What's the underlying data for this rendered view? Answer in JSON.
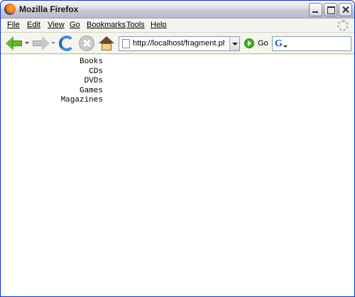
{
  "window": {
    "title": "Mozilla Firefox"
  },
  "menubar": {
    "items": [
      {
        "label": "File"
      },
      {
        "label": "Edit"
      },
      {
        "label": "View"
      },
      {
        "label": "Go"
      },
      {
        "label": "Bookmarks"
      },
      {
        "label": "Tools"
      },
      {
        "label": "Help"
      }
    ]
  },
  "toolbar": {
    "url": "http://localhost/fragment.php",
    "go_label": "Go",
    "search_engine_glyph": "G",
    "search_value": ""
  },
  "content": {
    "items": [
      "Books",
      "CDs",
      "DVDs",
      "Games",
      "Magazines"
    ]
  },
  "colors": {
    "accent_green": "#5cbe2a",
    "reload_blue": "#3b8fd8",
    "window_border": "#0831d9"
  }
}
